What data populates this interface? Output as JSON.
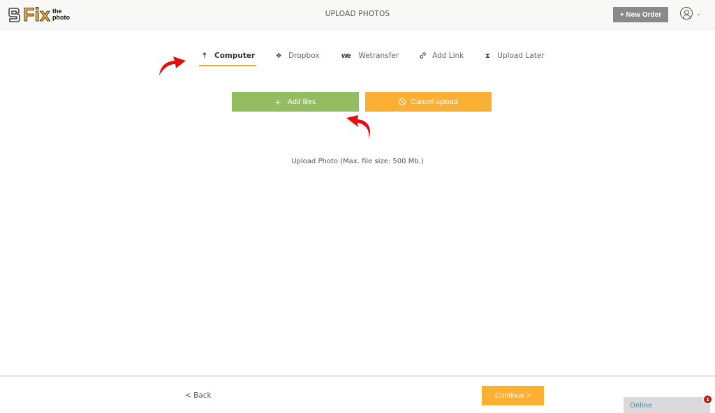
{
  "header": {
    "logo": {
      "main": "Fix",
      "sub_top": "the",
      "sub_bottom": "photo"
    },
    "title": "UPLOAD PHOTOS",
    "new_order_label": "+ New Order",
    "user_icon": "user-circle-icon",
    "user_menu_chevron": "⌄"
  },
  "tabs": [
    {
      "label": "Computer",
      "icon": "upload-icon",
      "glyph": "⤒",
      "active": true
    },
    {
      "label": "Dropbox",
      "icon": "dropbox-icon",
      "glyph": "❖",
      "active": false
    },
    {
      "label": "Wetransfer",
      "icon": "wetransfer-icon",
      "glyph": "we",
      "active": false
    },
    {
      "label": "Add Link",
      "icon": "link-icon",
      "glyph": "🔗",
      "active": false
    },
    {
      "label": "Upload Later",
      "icon": "hourglass-icon",
      "glyph": "⧗",
      "active": false
    }
  ],
  "actions": {
    "add_files_label": "Add files",
    "add_files_icon": "+",
    "cancel_upload_label": "Cancel upload"
  },
  "upload_note": "Upload Photo (Max. file size: 500 Mb.)",
  "footer": {
    "back_label": "< Back",
    "continue_label": "Continue >",
    "chat_status": "Online",
    "chat_badge_count": "1"
  },
  "colors": {
    "accent_orange": "#fbaf33",
    "add_green": "#94bc61",
    "new_order_gray": "#8a8a8a",
    "annotation_red": "#e01010",
    "online_blue": "#2a8fc1",
    "badge_red": "#c51616"
  }
}
